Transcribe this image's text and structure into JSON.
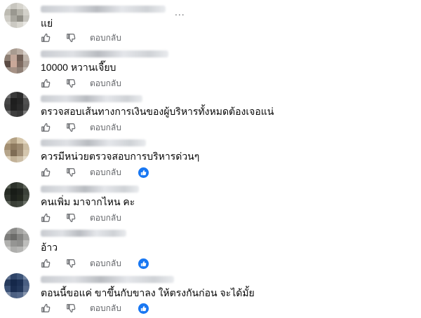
{
  "more_label": "...",
  "reply_label": "ตอบกลับ",
  "comments": [
    {
      "text": "แย่",
      "has_like_badge": false
    },
    {
      "text": "10000 หวานเจี๊ยบ",
      "has_like_badge": false
    },
    {
      "text": "ตรวจสอบเส้นทางการเงินของผู้บริหารทั้งหมดต้องเจอแน่",
      "has_like_badge": false
    },
    {
      "text": "ควรมีหน่วยตรวจสอบการบริหารด่วนๆ",
      "has_like_badge": true
    },
    {
      "text": "คนเพิ่ม มาจากไหน คะ",
      "has_like_badge": false
    },
    {
      "text": "อ้าว",
      "has_like_badge": true
    },
    {
      "text": "ตอนนี้ขอแค่ ขาขึ้นกับขาลง ให้ตรงกันก่อน จะได้มั้ย",
      "has_like_badge": true
    }
  ],
  "icons": {
    "like": "thumbs-up-icon",
    "dislike": "thumbs-down-icon",
    "reaction": "like-reaction-badge-icon"
  },
  "colors": {
    "text": "#050505",
    "secondary": "#65676b",
    "accent": "#1877f2"
  }
}
